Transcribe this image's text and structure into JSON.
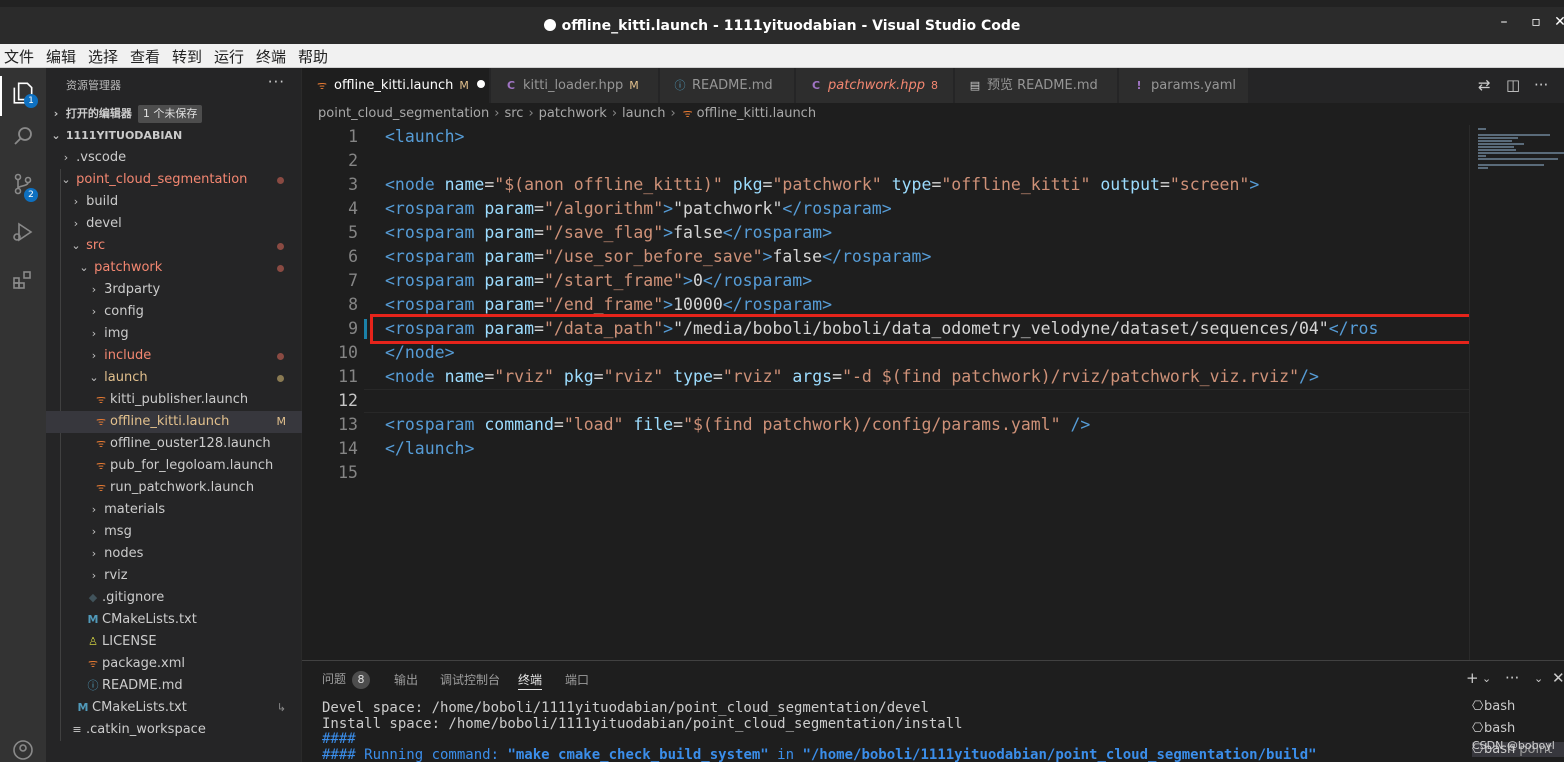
{
  "window": {
    "title": "offline_kitti.launch - 1111yituodabian - Visual Studio Code",
    "controls": [
      "–",
      "▫",
      "✕"
    ]
  },
  "menu": [
    "文件",
    "编辑",
    "选择",
    "查看",
    "转到",
    "运行",
    "终端",
    "帮助"
  ],
  "activity": {
    "badges": {
      "explorer": "1",
      "scm": "2"
    }
  },
  "sidebar": {
    "title": "资源管理器",
    "more": "···",
    "open_editors": {
      "label": "打开的编辑器",
      "unsaved": "1 个未保存"
    },
    "workspace": "1111YITUODABIAN",
    "tree": [
      {
        "label": ".vscode",
        "chev": "›",
        "depth": 0
      },
      {
        "label": "point_cloud_segmentation",
        "chev": "⌄",
        "depth": 0
      },
      {
        "label": "build",
        "chev": "›",
        "depth": 1
      },
      {
        "label": "devel",
        "chev": "›",
        "depth": 1
      },
      {
        "label": "src",
        "chev": "⌄",
        "depth": 1
      },
      {
        "label": "patchwork",
        "chev": "⌄",
        "depth": 2
      },
      {
        "label": "3rdparty",
        "chev": "›",
        "depth": 3
      },
      {
        "label": "config",
        "chev": "›",
        "depth": 3
      },
      {
        "label": "img",
        "chev": "›",
        "depth": 3
      },
      {
        "label": "include",
        "chev": "›",
        "depth": 3
      },
      {
        "label": "launch",
        "chev": "⌄",
        "depth": 3
      },
      {
        "label": "kitti_publisher.launch",
        "icon": "rss-icon",
        "depth": 4
      },
      {
        "label": "offline_kitti.launch",
        "icon": "rss-icon",
        "depth": 4,
        "modified": "M"
      },
      {
        "label": "offline_ouster128.launch",
        "icon": "rss-icon",
        "depth": 4
      },
      {
        "label": "pub_for_legoloam.launch",
        "icon": "rss-icon",
        "depth": 4
      },
      {
        "label": "run_patchwork.launch",
        "icon": "rss-icon",
        "depth": 4
      },
      {
        "label": "materials",
        "chev": "›",
        "depth": 3
      },
      {
        "label": "msg",
        "chev": "›",
        "depth": 3
      },
      {
        "label": "nodes",
        "chev": "›",
        "depth": 3
      },
      {
        "label": "rviz",
        "chev": "›",
        "depth": 3
      },
      {
        "label": ".gitignore",
        "icon": "diamond-icon",
        "depth": 3
      },
      {
        "label": "CMakeLists.txt",
        "icon": "M",
        "depth": 3
      },
      {
        "label": "LICENSE",
        "icon": "person-icon",
        "depth": 3
      },
      {
        "label": "package.xml",
        "icon": "rss-icon",
        "depth": 3
      },
      {
        "label": "README.md",
        "icon": "info-icon",
        "depth": 3
      },
      {
        "label": "CMakeLists.txt",
        "icon": "M",
        "depth": 2,
        "link": "↳"
      },
      {
        "label": ".catkin_workspace",
        "icon": "lines-icon",
        "depth": 2
      }
    ]
  },
  "tabs": [
    {
      "label": "offline_kitti.launch",
      "icon": "rss-icon",
      "flag": "M",
      "dirty": true
    },
    {
      "label": "kitti_loader.hpp",
      "icon": "C",
      "flag": "M"
    },
    {
      "label": "README.md",
      "icon": "info-icon"
    },
    {
      "label": "patchwork.hpp",
      "icon": "C",
      "flag": "8"
    },
    {
      "label": "预览 README.md",
      "icon": "preview-icon"
    },
    {
      "label": "params.yaml",
      "icon": "!"
    }
  ],
  "breadcrumb": [
    "point_cloud_segmentation",
    "src",
    "patchwork",
    "launch",
    "offline_kitti.launch"
  ],
  "editor": {
    "line_numbers": [
      "1",
      "2",
      "3",
      "4",
      "5",
      "6",
      "7",
      "8",
      "9",
      "10",
      "11",
      "12",
      "13",
      "14",
      "15"
    ],
    "lines": [
      [
        [
          "tg",
          "<launch>"
        ]
      ],
      [],
      [
        [
          "tg",
          "<node "
        ],
        [
          "at",
          "name"
        ],
        [
          "tx",
          "="
        ],
        [
          "st",
          "\"$(anon offline_kitti)\""
        ],
        [
          "tx",
          " "
        ],
        [
          "at",
          "pkg"
        ],
        [
          "tx",
          "="
        ],
        [
          "st",
          "\"patchwork\""
        ],
        [
          "tx",
          " "
        ],
        [
          "at",
          "type"
        ],
        [
          "tx",
          "="
        ],
        [
          "st",
          "\"offline_kitti\""
        ],
        [
          "tx",
          " "
        ],
        [
          "at",
          "output"
        ],
        [
          "tx",
          "="
        ],
        [
          "st",
          "\"screen\""
        ],
        [
          "tg",
          ">"
        ]
      ],
      [
        [
          "tg",
          "<rosparam "
        ],
        [
          "at",
          "param"
        ],
        [
          "tx",
          "="
        ],
        [
          "st",
          "\"/algorithm\""
        ],
        [
          "tg",
          ">"
        ],
        [
          "tx",
          "\"patchwork\""
        ],
        [
          "tg",
          "</rosparam>"
        ]
      ],
      [
        [
          "tg",
          "<rosparam "
        ],
        [
          "at",
          "param"
        ],
        [
          "tx",
          "="
        ],
        [
          "st",
          "\"/save_flag\""
        ],
        [
          "tg",
          ">"
        ],
        [
          "tx",
          "false"
        ],
        [
          "tg",
          "</rosparam>"
        ]
      ],
      [
        [
          "tg",
          "<rosparam "
        ],
        [
          "at",
          "param"
        ],
        [
          "tx",
          "="
        ],
        [
          "st",
          "\"/use_sor_before_save\""
        ],
        [
          "tg",
          ">"
        ],
        [
          "tx",
          "false"
        ],
        [
          "tg",
          "</rosparam>"
        ]
      ],
      [
        [
          "tg",
          "<rosparam "
        ],
        [
          "at",
          "param"
        ],
        [
          "tx",
          "="
        ],
        [
          "st",
          "\"/start_frame\""
        ],
        [
          "tg",
          ">"
        ],
        [
          "tx",
          "0"
        ],
        [
          "tg",
          "</rosparam>"
        ]
      ],
      [
        [
          "tg",
          "<rosparam "
        ],
        [
          "at",
          "param"
        ],
        [
          "tx",
          "="
        ],
        [
          "st",
          "\"/end_frame\""
        ],
        [
          "tg",
          ">"
        ],
        [
          "tx",
          "10000"
        ],
        [
          "tg",
          "</rosparam>"
        ]
      ],
      [
        [
          "tg",
          "<rosparam "
        ],
        [
          "at",
          "param"
        ],
        [
          "tx",
          "="
        ],
        [
          "st",
          "\"/data_path\""
        ],
        [
          "tg",
          ">"
        ],
        [
          "tx",
          "\"/media/boboli/boboli/data_odometry_velodyne/dataset/sequences/04\""
        ],
        [
          "tg",
          "</ros"
        ]
      ],
      [
        [
          "tg",
          "</node>"
        ]
      ],
      [
        [
          "tg",
          "<node "
        ],
        [
          "at",
          "name"
        ],
        [
          "tx",
          "="
        ],
        [
          "st",
          "\"rviz\""
        ],
        [
          "tx",
          " "
        ],
        [
          "at",
          "pkg"
        ],
        [
          "tx",
          "="
        ],
        [
          "st",
          "\"rviz\""
        ],
        [
          "tx",
          " "
        ],
        [
          "at",
          "type"
        ],
        [
          "tx",
          "="
        ],
        [
          "st",
          "\"rviz\""
        ],
        [
          "tx",
          " "
        ],
        [
          "at",
          "args"
        ],
        [
          "tx",
          "="
        ],
        [
          "st",
          "\"-d $(find patchwork)/rviz/patchwork_viz.rviz\""
        ],
        [
          "tg",
          "/>"
        ]
      ],
      [],
      [
        [
          "tg",
          "<rosparam "
        ],
        [
          "at",
          "command"
        ],
        [
          "tx",
          "="
        ],
        [
          "st",
          "\"load\""
        ],
        [
          "tx",
          " "
        ],
        [
          "at",
          "file"
        ],
        [
          "tx",
          "="
        ],
        [
          "st",
          "\"$(find patchwork)/config/params.yaml\""
        ],
        [
          "tx",
          " "
        ],
        [
          "tg",
          "/>"
        ]
      ],
      [
        [
          "tg",
          "</launch>"
        ]
      ],
      []
    ]
  },
  "panel": {
    "tabs": [
      "问题",
      "输出",
      "调试控制台",
      "终端",
      "端口"
    ],
    "problems_count": "8",
    "actions": [
      "+",
      "⌄",
      "···",
      "⌄",
      "✕"
    ],
    "terminal_lines": [
      [
        [
          "tx",
          "Devel space: /home/boboli/1111yituodabian/point_cloud_segmentation/devel"
        ]
      ],
      [
        [
          "tx",
          "Install space: /home/boboli/1111yituodabian/point_cloud_segmentation/install"
        ]
      ],
      [
        [
          "b",
          "####"
        ]
      ],
      [
        [
          "b",
          "#### Running command: "
        ],
        [
          "bb",
          "\"make cmake_check_build_system\""
        ],
        [
          "b",
          " in "
        ],
        [
          "bb",
          "\"/home/boboli/1111yituodabian/point_cloud_segmentation/build\""
        ]
      ]
    ],
    "terminals": [
      "bash",
      "bash",
      "bash"
    ],
    "watermark": "CSDN @boboyl",
    "cut_text": "point"
  },
  "colors": {
    "accent": "#0e70c0",
    "highlight_box": "#e6241b",
    "tag": "#569cd6",
    "attr": "#9cdcfe",
    "string": "#ce9178"
  }
}
